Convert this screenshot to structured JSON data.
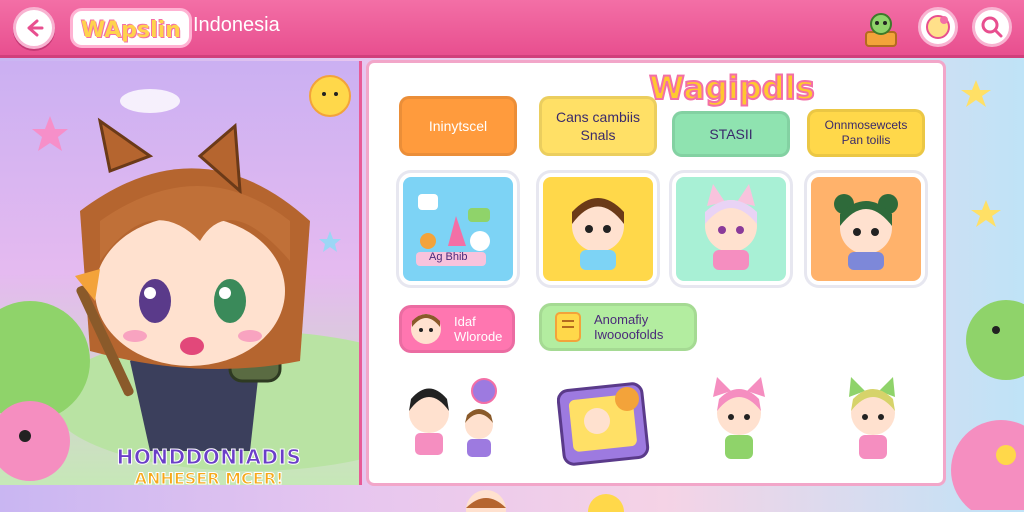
{
  "header": {
    "logo_text": "WApslin",
    "country": "Indonesia"
  },
  "promo": {
    "line1": "HONDDONIADIS",
    "line2": "ANHESER MCER!"
  },
  "panel": {
    "title": "Wagipdls"
  },
  "categories": [
    {
      "label": "Ininytscel",
      "color": "#ff9b3d"
    },
    {
      "label": "Cans cambiis\nSnals",
      "color": "#ffe066"
    },
    {
      "label": "STASII",
      "color": "#8fe3b0"
    },
    {
      "label": "Onnmosewcets\nPan toilis",
      "color": "#ffd84a"
    }
  ],
  "tiles": [
    {
      "name": "activities",
      "label": "Ag Bhib",
      "color": "#7dd3f5"
    },
    {
      "name": "boy",
      "color": "#ffd84a"
    },
    {
      "name": "cat-girl",
      "color": "#a8f0d5"
    },
    {
      "name": "green-hair",
      "color": "#ffb26b"
    }
  ],
  "pills": [
    {
      "label": "Idaf\nWlorode",
      "color": "#ff76b0"
    },
    {
      "label": "Anomafiy\nIwoooofolds",
      "color": "#b3eda0"
    }
  ],
  "icons": {
    "back": "back-arrow-icon",
    "search": "search-icon",
    "profile": "face-icon"
  }
}
